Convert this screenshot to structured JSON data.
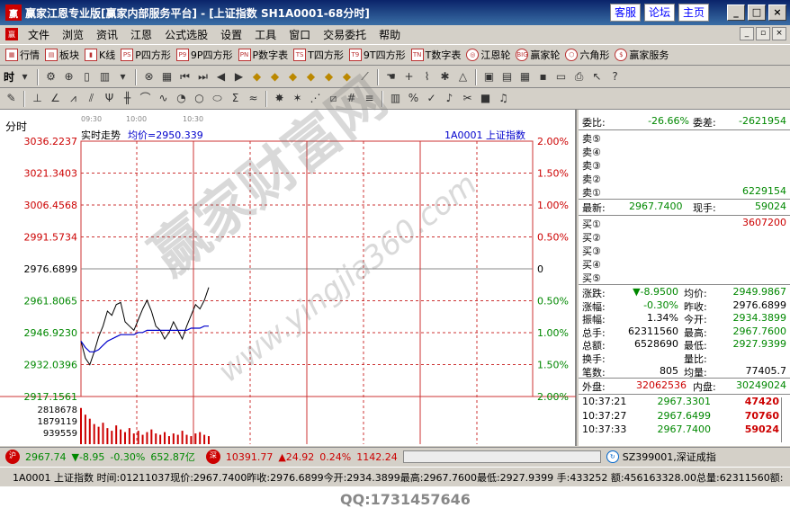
{
  "window": {
    "title": "赢家江恩专业版[赢家内部服务平台] - [上证指数   SH1A0001-68分时]",
    "logo": "赢",
    "links": [
      "客服",
      "论坛",
      "主页"
    ],
    "controls": [
      "_",
      "□",
      "×"
    ]
  },
  "menu": {
    "items": [
      "文件",
      "浏览",
      "资讯",
      "江恩",
      "公式选股",
      "设置",
      "工具",
      "窗口",
      "交易委托",
      "帮助"
    ],
    "right": [
      "_",
      "▫",
      "×"
    ]
  },
  "toolbar": {
    "items": [
      {
        "label": "行情",
        "icon": "grid-icon"
      },
      {
        "label": "板块",
        "icon": "blocks-icon"
      },
      {
        "label": "K线",
        "icon": "kline-icon"
      },
      {
        "label": "P四方形",
        "icon": "PS"
      },
      {
        "label": "9P四方形",
        "icon": "P9"
      },
      {
        "label": "P数字表",
        "icon": "PN"
      },
      {
        "label": "T四方形",
        "icon": "TS"
      },
      {
        "label": "9T四方形",
        "icon": "T9"
      },
      {
        "label": "T数字表",
        "icon": "TN"
      },
      {
        "label": "江恩轮",
        "icon": "wheel-icon"
      },
      {
        "label": "赢家轮",
        "icon": "BIG"
      },
      {
        "label": "六角形",
        "icon": "hex-icon"
      },
      {
        "label": "赢家服务",
        "icon": "dollar-icon"
      }
    ]
  },
  "toolbar2": {
    "time_label": "时"
  },
  "chart": {
    "title_label": "分时",
    "times": [
      "09:30",
      "10:00",
      "10:30"
    ],
    "caption": "实时走势",
    "avg_label": "均价=2950.339",
    "code_label": "1A0001  上证指数",
    "watermark": "赢家财富网",
    "watermark2": "www.yingjia360.com",
    "qq": "QQ:1731457646",
    "y_left": [
      "3036.2237",
      "3021.3403",
      "3006.4568",
      "2991.5734",
      "2976.6899",
      "2961.8065",
      "2946.9230",
      "2932.0396",
      "2917.1561"
    ],
    "y_right": [
      "2.00%",
      "1.50%",
      "1.00%",
      "0.50%",
      "0",
      "0.50%",
      "1.00%",
      "1.50%",
      "2.00%"
    ],
    "vol_labels": [
      "2818678",
      "1879119",
      "939559"
    ]
  },
  "chart_data": {
    "type": "line",
    "series": [
      {
        "values": [
          2943,
          2935,
          2932,
          2938,
          2945,
          2950,
          2957,
          2955,
          2960,
          2961,
          2952,
          2950,
          2948,
          2953,
          2958,
          2962,
          2957,
          2950,
          2948,
          2944,
          2947,
          2952,
          2948,
          2944,
          2950,
          2955,
          2960,
          2958,
          2962,
          2968
        ]
      },
      {
        "values": [
          2943,
          2940,
          2938,
          2938,
          2939,
          2941,
          2943,
          2944,
          2945,
          2946,
          2946,
          2946,
          2946,
          2947,
          2947,
          2948,
          2948,
          2948,
          2948,
          2948,
          2948,
          2948,
          2948,
          2948,
          2948,
          2949,
          2949,
          2949,
          2950,
          2950
        ]
      }
    ],
    "volume": [
      2700000,
      2200000,
      1900000,
      1500000,
      1300000,
      1600000,
      1200000,
      1000000,
      1400000,
      1100000,
      900000,
      1200000,
      800000,
      1000000,
      700000,
      900000,
      1100000,
      800000,
      700000,
      900000,
      600000,
      800000,
      700000,
      1000000,
      700000,
      600000,
      800000,
      900000,
      700000,
      600000
    ],
    "ylim": [
      2917.1561,
      3036.2237
    ],
    "base": 2976.6899
  },
  "panel": {
    "wb_label": "委比:",
    "wb": "-26.66%",
    "wc_label": "委差:",
    "wc": "-2621954",
    "sells": [
      {
        "label": "卖⑤",
        "price": "",
        "vol": ""
      },
      {
        "label": "卖④",
        "price": "",
        "vol": ""
      },
      {
        "label": "卖③",
        "price": "",
        "vol": ""
      },
      {
        "label": "卖②",
        "price": "",
        "vol": ""
      },
      {
        "label": "卖①",
        "price": "",
        "vol": "6229154"
      }
    ],
    "last_label": "最新:",
    "last": "2967.7400",
    "xs_label": "现手:",
    "xs": "59024",
    "buys": [
      {
        "label": "买①",
        "vol": "3607200"
      },
      {
        "label": "买②",
        "vol": ""
      },
      {
        "label": "买③",
        "vol": ""
      },
      {
        "label": "买④",
        "vol": ""
      },
      {
        "label": "买⑤",
        "vol": ""
      }
    ],
    "stats": [
      {
        "l1": "涨跌:",
        "v1": "▼-8.9500",
        "l2": "均价:",
        "v2": "2949.9867",
        "c1": "green",
        "c2": "green"
      },
      {
        "l1": "涨幅:",
        "v1": "-0.30%",
        "l2": "昨收:",
        "v2": "2976.6899",
        "c1": "green",
        "c2": "black"
      },
      {
        "l1": "振幅:",
        "v1": "1.34%",
        "l2": "今开:",
        "v2": "2934.3899",
        "c1": "black",
        "c2": "green"
      },
      {
        "l1": "总手:",
        "v1": "62311560",
        "l2": "最高:",
        "v2": "2967.7600",
        "c1": "black",
        "c2": "green"
      },
      {
        "l1": "总额:",
        "v1": "6528690",
        "l2": "最低:",
        "v2": "2927.9399",
        "c1": "black",
        "c2": "green"
      },
      {
        "l1": "换手:",
        "v1": "",
        "l2": "量比:",
        "v2": "",
        "c1": "black",
        "c2": "black"
      },
      {
        "l1": "笔数:",
        "v1": "805",
        "l2": "均量:",
        "v2": "77405.7",
        "c1": "black",
        "c2": "black"
      }
    ],
    "wp_label": "外盘:",
    "wp": "32062536",
    "np_label": "内盘:",
    "np": "30249024",
    "ticks": [
      {
        "time": "10:37:21",
        "price": "2967.3301",
        "vol": "47420"
      },
      {
        "time": "10:37:27",
        "price": "2967.6499",
        "vol": "70760"
      },
      {
        "time": "10:37:33",
        "price": "2967.7400",
        "vol": "59024"
      }
    ]
  },
  "status": {
    "sh_label": "沪",
    "sh_price": "2967.74",
    "sh_chg": "▼-8.95",
    "sh_pct": "-0.30%",
    "sh_amt": "652.87亿",
    "sz_label": "深",
    "sz_price": "10391.77",
    "sz_chg": "▲24.92",
    "sz_pct": "0.24%",
    "sz_amt": "1142.24",
    "sz_code": "SZ399001,深证成指",
    "line2": "1A0001  上证指数  时间:01211037现价:2967.7400昨收:2976.6899今开:2934.3899最高:2967.7600最低:2927.9399 手:433252 额:456163328.00总量:62311560额:"
  }
}
